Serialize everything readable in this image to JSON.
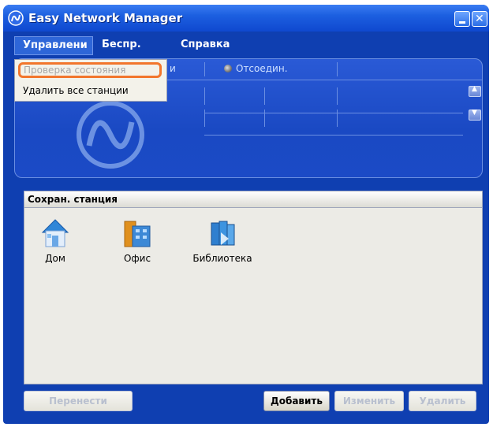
{
  "window": {
    "title": "Easy Network Manager",
    "accent": "#0f3fb1"
  },
  "menubar": {
    "items": [
      "Управлени",
      "Беспр.",
      "Справка"
    ]
  },
  "dropdown": {
    "items": [
      {
        "label": "Проверка состояния",
        "state": "disabled-highlighted"
      },
      {
        "label": "Удалить все станции",
        "state": "enabled"
      }
    ]
  },
  "status": {
    "col_fragment": "и",
    "connection": "Отсоедин."
  },
  "saved": {
    "title": "Сохран. станция",
    "stations": [
      {
        "label": "Дом",
        "icon": "home-icon"
      },
      {
        "label": "Офис",
        "icon": "office-icon"
      },
      {
        "label": "Библиотека",
        "icon": "library-icon"
      }
    ]
  },
  "buttons": {
    "transfer": "Перенести",
    "add": "Добавить",
    "edit": "Изменить",
    "delete": "Удалить"
  }
}
